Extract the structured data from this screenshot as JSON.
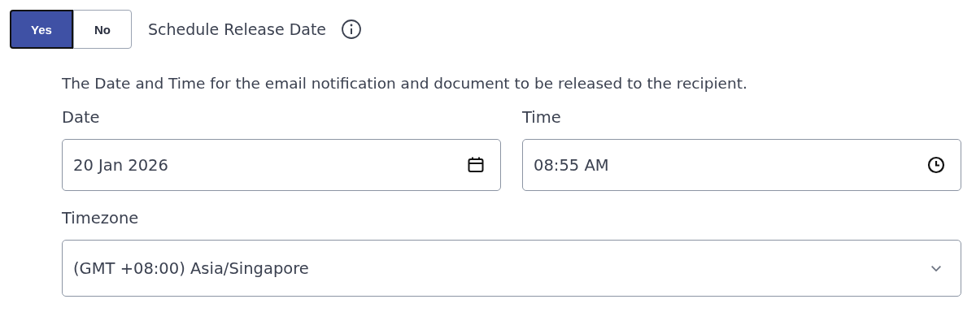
{
  "toggle": {
    "options": [
      {
        "label": "Yes",
        "selected": true
      },
      {
        "label": "No",
        "selected": false
      }
    ]
  },
  "title": "Schedule Release Date",
  "description": "The Date and Time for the email notification and document to be released to the recipient.",
  "date": {
    "label": "Date",
    "value": "20 Jan 2026"
  },
  "time": {
    "label": "Time",
    "value": "08:55 AM"
  },
  "timezone": {
    "label": "Timezone",
    "value": "(GMT +08:00) Asia/Singapore"
  }
}
